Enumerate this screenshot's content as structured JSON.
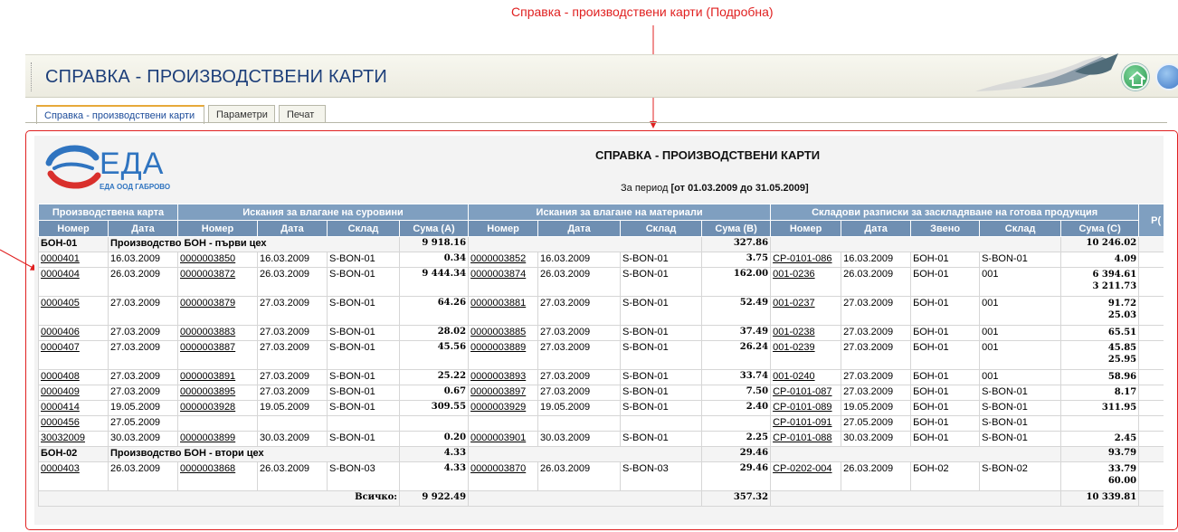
{
  "annotation": "Справка - производствени карти (Подробна)",
  "header": {
    "title": "СПРАВКА - ПРОИЗВОДСТВЕНИ КАРТИ"
  },
  "tabs": [
    {
      "label": "Справка - производствени карти"
    },
    {
      "label": "Параметри"
    },
    {
      "label": "Печат"
    }
  ],
  "logo": {
    "name": "ЕДА",
    "subtitle": "ЕДА ООД ГАБРОВО"
  },
  "report": {
    "title": "СПРАВКА - ПРОИЗВОДСТВЕНИ КАРТИ",
    "period_prefix": "За период",
    "period_value": "[от 01.03.2009 до 31.05.2009]"
  },
  "table": {
    "groups": [
      "Производствена карта",
      "Искания за влагане на суровини",
      "Искания за влагане на материали",
      "Складови разписки за заскладяване на готова продукция",
      "Р("
    ],
    "subheaders": [
      "Номер",
      "Дата",
      "Номер",
      "Дата",
      "Склад",
      "Сума (А)",
      "Номер",
      "Дата",
      "Склад",
      "Сума (В)",
      "Номер",
      "Дата",
      "Звено",
      "Склад",
      "Сума (С)"
    ],
    "group1": {
      "code": "БОН-01",
      "name": "Производство БОН - първи цех",
      "sumA": "9 918.16",
      "sumB": "327.86",
      "sumC": "10 246.02"
    },
    "rows1": [
      {
        "c": [
          "0000401",
          "16.03.2009",
          "0000003850",
          "16.03.2009",
          "S-BON-01",
          "0.34",
          "0000003852",
          "16.03.2009",
          "S-BON-01",
          "3.75",
          "CP-0101-086",
          "16.03.2009",
          "БОН-01",
          "S-BON-01",
          "4.09"
        ],
        "c2": ""
      },
      {
        "c": [
          "0000404",
          "26.03.2009",
          "0000003872",
          "26.03.2009",
          "S-BON-01",
          "9 444.34",
          "0000003874",
          "26.03.2009",
          "S-BON-01",
          "162.00",
          "001-0236",
          "26.03.2009",
          "БОН-01",
          "001",
          "6 394.61"
        ],
        "c2": "3 211.73"
      },
      {
        "c": [
          "0000405",
          "27.03.2009",
          "0000003879",
          "27.03.2009",
          "S-BON-01",
          "64.26",
          "0000003881",
          "27.03.2009",
          "S-BON-01",
          "52.49",
          "001-0237",
          "27.03.2009",
          "БОН-01",
          "001",
          "91.72"
        ],
        "c2": "25.03"
      },
      {
        "c": [
          "0000406",
          "27.03.2009",
          "0000003883",
          "27.03.2009",
          "S-BON-01",
          "28.02",
          "0000003885",
          "27.03.2009",
          "S-BON-01",
          "37.49",
          "001-0238",
          "27.03.2009",
          "БОН-01",
          "001",
          "65.51"
        ],
        "c2": ""
      },
      {
        "c": [
          "0000407",
          "27.03.2009",
          "0000003887",
          "27.03.2009",
          "S-BON-01",
          "45.56",
          "0000003889",
          "27.03.2009",
          "S-BON-01",
          "26.24",
          "001-0239",
          "27.03.2009",
          "БОН-01",
          "001",
          "45.85"
        ],
        "c2": "25.95"
      },
      {
        "c": [
          "0000408",
          "27.03.2009",
          "0000003891",
          "27.03.2009",
          "S-BON-01",
          "25.22",
          "0000003893",
          "27.03.2009",
          "S-BON-01",
          "33.74",
          "001-0240",
          "27.03.2009",
          "БОН-01",
          "001",
          "58.96"
        ],
        "c2": ""
      },
      {
        "c": [
          "0000409",
          "27.03.2009",
          "0000003895",
          "27.03.2009",
          "S-BON-01",
          "0.67",
          "0000003897",
          "27.03.2009",
          "S-BON-01",
          "7.50",
          "CP-0101-087",
          "27.03.2009",
          "БОН-01",
          "S-BON-01",
          "8.17"
        ],
        "c2": ""
      },
      {
        "c": [
          "0000414",
          "19.05.2009",
          "0000003928",
          "19.05.2009",
          "S-BON-01",
          "309.55",
          "0000003929",
          "19.05.2009",
          "S-BON-01",
          "2.40",
          "CP-0101-089",
          "19.05.2009",
          "БОН-01",
          "S-BON-01",
          "311.95"
        ],
        "c2": ""
      },
      {
        "c": [
          "0000456",
          "27.05.2009",
          "",
          "",
          "",
          "",
          "",
          "",
          "",
          "",
          "CP-0101-091",
          "27.05.2009",
          "БОН-01",
          "S-BON-01",
          ""
        ],
        "c2": ""
      },
      {
        "c": [
          "30032009",
          "30.03.2009",
          "0000003899",
          "30.03.2009",
          "S-BON-01",
          "0.20",
          "0000003901",
          "30.03.2009",
          "S-BON-01",
          "2.25",
          "CP-0101-088",
          "30.03.2009",
          "БОН-01",
          "S-BON-01",
          "2.45"
        ],
        "c2": ""
      }
    ],
    "group2": {
      "code": "БОН-02",
      "name": "Производство БОН - втори цех",
      "sumA": "4.33",
      "sumB": "29.46",
      "sumC": "93.79"
    },
    "rows2": [
      {
        "c": [
          "0000403",
          "26.03.2009",
          "0000003868",
          "26.03.2009",
          "S-BON-03",
          "4.33",
          "0000003870",
          "26.03.2009",
          "S-BON-03",
          "29.46",
          "CP-0202-004",
          "26.03.2009",
          "БОН-02",
          "S-BON-02",
          "33.79"
        ],
        "c2": "60.00"
      }
    ],
    "total": {
      "label": "Всичко:",
      "sumA": "9 922.49",
      "sumB": "357.32",
      "sumC": "10 339.81"
    }
  }
}
